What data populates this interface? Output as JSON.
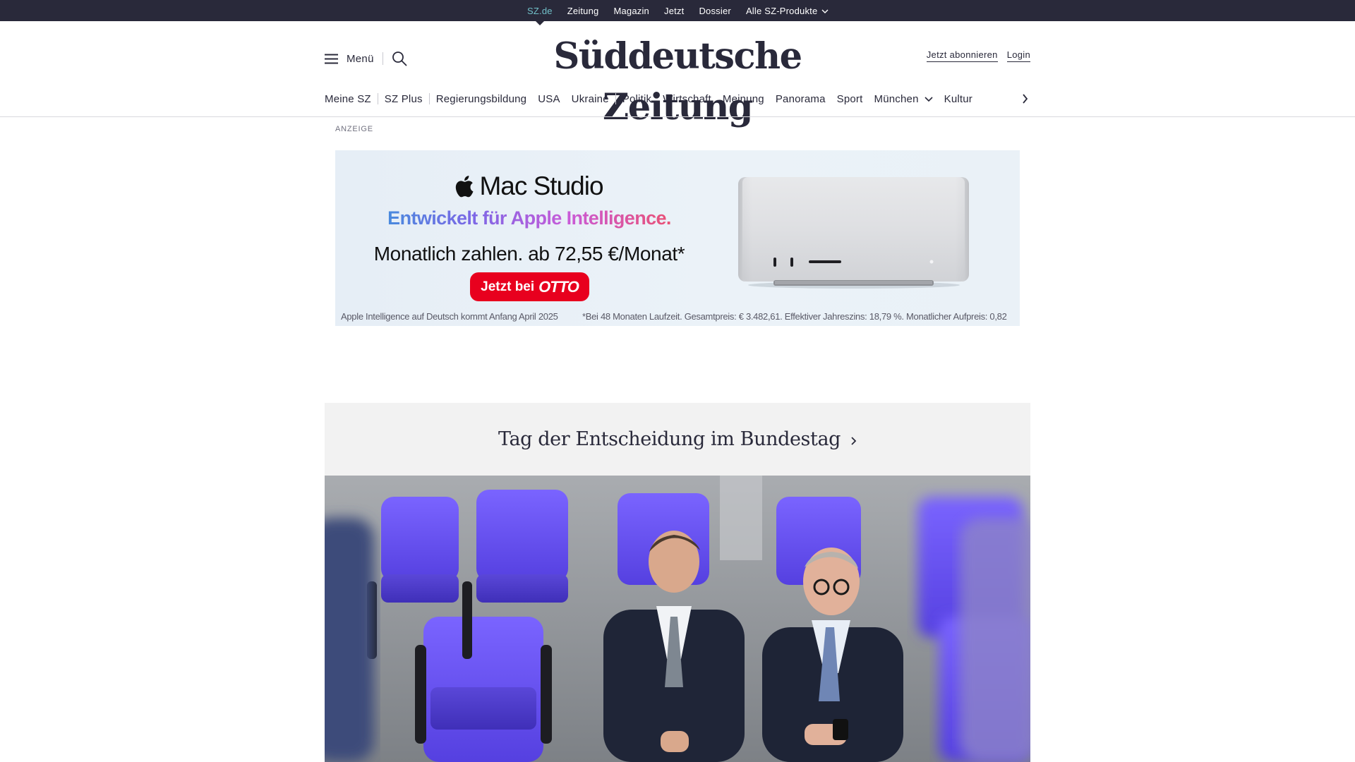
{
  "topbar": {
    "links": [
      "SZ.de",
      "Zeitung",
      "Magazin",
      "Jetzt",
      "Dossier",
      "Alle SZ-Produkte"
    ]
  },
  "header": {
    "menu_label": "Menü",
    "logo": "Süddeutsche Zeitung",
    "subscribe": "Jetzt abonnieren",
    "login": "Login"
  },
  "nav": {
    "items": [
      "Meine SZ",
      "SZ Plus",
      "Regierungsbildung",
      "USA",
      "Ukraine",
      "Politik",
      "Wirtschaft",
      "Meinung",
      "Panorama",
      "Sport",
      "München",
      "Kultur"
    ]
  },
  "ad": {
    "label": "ANZEIGE",
    "brand": "Mac Studio",
    "tagline": "Entwickelt für Apple Intelligence.",
    "price": "Monatlich zahlen. ab 72,55 €/Monat*",
    "cta_prefix": "Jetzt bei",
    "cta_brand": "OTTO",
    "fine_left": "Apple Intelligence auf Deutsch kommt Anfang April 2025",
    "fine_right": "*Bei 48 Monaten Laufzeit. Gesamtpreis: € 3.482,61. Effektiver Jahreszins: 18,79 %. Monatlicher Aufpreis: 0,82"
  },
  "topic": {
    "title": "Tag der Entscheidung im Bundestag"
  },
  "icons": {
    "menu": "hamburger-icon",
    "search": "search-icon",
    "dropdown": "chevron-down-icon",
    "next": "chevron-right-icon",
    "apple": "apple-logo-icon"
  },
  "colors": {
    "topbar": "#29293a",
    "active_link": "#71c0c9",
    "cta_red": "#e8001e",
    "topic_bg": "#f2f2f2",
    "chair_purple": "#6b55f0"
  }
}
